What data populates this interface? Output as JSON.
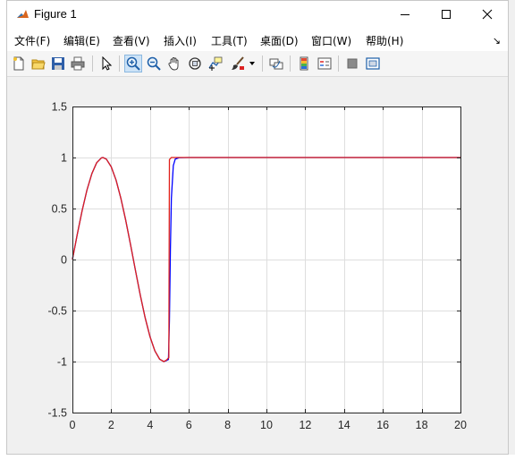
{
  "window": {
    "title": "Figure 1"
  },
  "menu": [
    "文件(F)",
    "编辑(E)",
    "查看(V)",
    "插入(I)",
    "工具(T)",
    "桌面(D)",
    "窗口(W)",
    "帮助(H)"
  ],
  "menu_corner": "↘",
  "toolbar": [
    {
      "icon": "new-figure-icon"
    },
    {
      "icon": "open-file-icon"
    },
    {
      "icon": "save-icon"
    },
    {
      "icon": "print-icon"
    },
    {
      "icon": "select-arrow-icon"
    },
    {
      "icon": "zoom-in-icon",
      "active": true
    },
    {
      "icon": "zoom-out-icon"
    },
    {
      "icon": "pan-hand-icon"
    },
    {
      "icon": "rotate-3d-icon"
    },
    {
      "icon": "data-cursor-icon"
    },
    {
      "icon": "brush-icon"
    },
    {
      "icon": "brush-dropdown-icon"
    },
    {
      "icon": "link-plot-icon"
    },
    {
      "icon": "colorbar-icon"
    },
    {
      "icon": "legend-icon"
    },
    {
      "icon": "hide-plot-tools-icon"
    },
    {
      "icon": "show-plot-tools-icon"
    }
  ],
  "colors": {
    "series_blue": "#0000ff",
    "series_red": "#e0201b",
    "axis": "#262626",
    "grid": "#dedede"
  },
  "chart_data": {
    "type": "line",
    "title": "",
    "xlabel": "",
    "ylabel": "",
    "xlim": [
      0,
      20
    ],
    "ylim": [
      -1.5,
      1.5
    ],
    "xticks": [
      "0",
      "2",
      "4",
      "6",
      "8",
      "10",
      "12",
      "14",
      "16",
      "18",
      "20"
    ],
    "yticks": [
      "-1.5",
      "-1",
      "-0.5",
      "0",
      "0.5",
      "1",
      "1.5"
    ],
    "grid": true,
    "series": [
      {
        "color": "#0000ff",
        "x": [
          0,
          0.25,
          0.5,
          0.75,
          1.0,
          1.25,
          1.5,
          1.57,
          1.75,
          2.0,
          2.25,
          2.5,
          2.75,
          3.0,
          3.25,
          3.5,
          3.75,
          4.0,
          4.25,
          4.5,
          4.71,
          4.85,
          4.95,
          5.0,
          5.05,
          5.1,
          5.2,
          5.3,
          5.5,
          6.0,
          8.0,
          10.0,
          12.0,
          14.0,
          16.0,
          18.0,
          20.0
        ],
        "y": [
          0,
          0.247,
          0.479,
          0.682,
          0.841,
          0.949,
          0.997,
          1.0,
          0.984,
          0.909,
          0.778,
          0.598,
          0.382,
          0.141,
          -0.108,
          -0.351,
          -0.572,
          -0.757,
          -0.895,
          -0.978,
          -1.0,
          -0.99,
          -0.98,
          -0.6,
          0.1,
          0.6,
          0.92,
          0.985,
          0.998,
          1.0,
          1.0,
          1.0,
          1.0,
          1.0,
          1.0,
          1.0,
          1.0
        ]
      },
      {
        "color": "#e0201b",
        "x": [
          0,
          0.25,
          0.5,
          0.75,
          1.0,
          1.25,
          1.5,
          1.57,
          1.75,
          2.0,
          2.25,
          2.5,
          2.75,
          3.0,
          3.25,
          3.5,
          3.75,
          4.0,
          4.25,
          4.5,
          4.71,
          4.85,
          4.97,
          5.0,
          5.05,
          5.1,
          5.3,
          5.5,
          6.0,
          8.0,
          10.0,
          12.0,
          14.0,
          16.0,
          18.0,
          20.0
        ],
        "y": [
          0,
          0.247,
          0.479,
          0.682,
          0.841,
          0.949,
          0.997,
          1.0,
          0.984,
          0.909,
          0.778,
          0.598,
          0.382,
          0.141,
          -0.108,
          -0.351,
          -0.572,
          -0.757,
          -0.895,
          -0.978,
          -1.0,
          -0.985,
          -0.96,
          0.98,
          0.99,
          1.0,
          1.0,
          1.0,
          1.0,
          1.0,
          1.0,
          1.0,
          1.0,
          1.0,
          1.0,
          1.0
        ]
      }
    ]
  }
}
